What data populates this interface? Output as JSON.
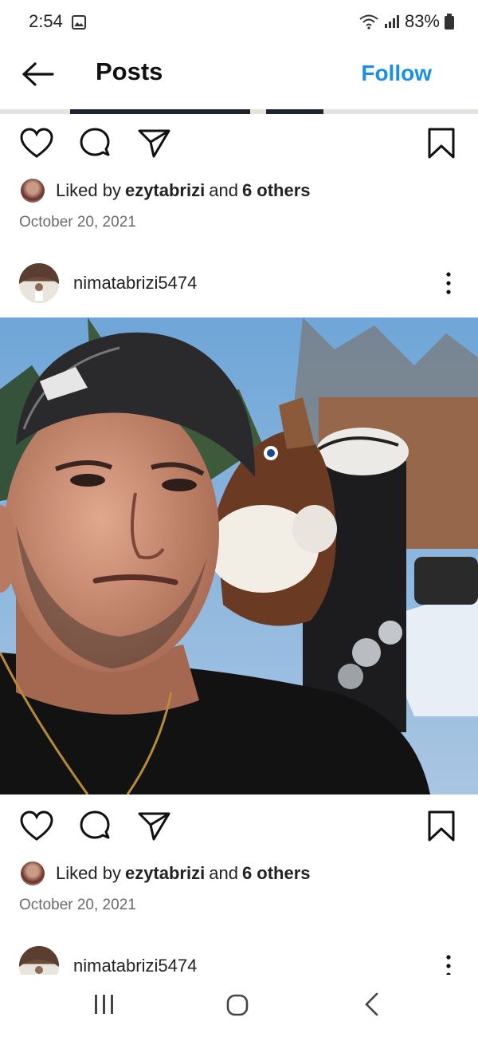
{
  "status": {
    "time": "2:54",
    "battery": "83%"
  },
  "header": {
    "title": "Posts",
    "follow_label": "Follow"
  },
  "post1": {
    "liked_prefix": "Liked by",
    "liked_user": "ezytabrizi",
    "liked_mid": "and",
    "liked_others": "6 others",
    "date": "October 20, 2021"
  },
  "post2": {
    "username": "nimatabrizi5474",
    "liked_prefix": "Liked by",
    "liked_user": "ezytabrizi",
    "liked_mid": "and",
    "liked_others": "6 others",
    "date": "October 20, 2021"
  },
  "post3": {
    "username": "nimatabrizi5474"
  },
  "icons": [
    "back-arrow",
    "heart",
    "comment",
    "share",
    "bookmark",
    "more-vertical",
    "recent-apps",
    "home",
    "back"
  ],
  "colors": {
    "accent": "#1a8fe8",
    "text": "#111111",
    "muted": "#6b6b6b"
  }
}
